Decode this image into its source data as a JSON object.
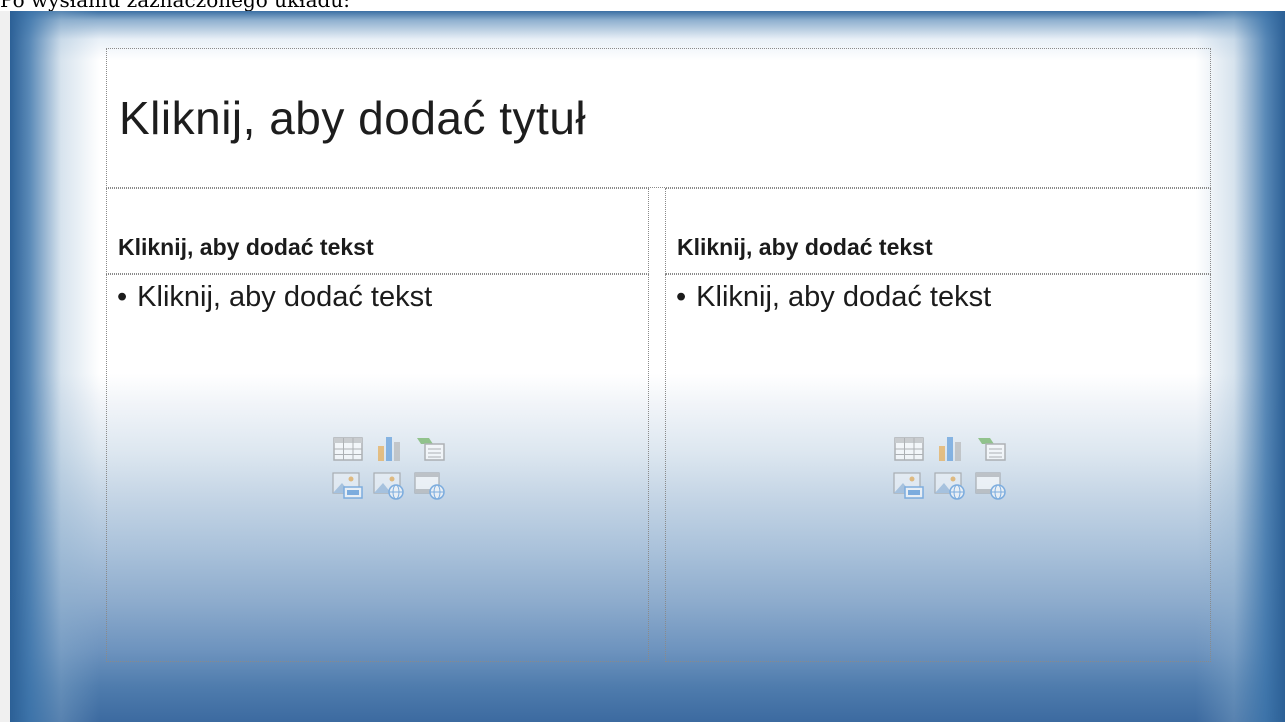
{
  "caption": {
    "text": "Po wysłaniu zaznaczonego układu:"
  },
  "slide": {
    "title_placeholder": "Kliknij, aby dodać tytuł",
    "columns": [
      {
        "heading_placeholder": "Kliknij, aby dodać tekst",
        "bullet": "•",
        "body_placeholder": "Kliknij, aby dodać tekst",
        "insert_icons": [
          "table-icon",
          "chart-icon",
          "smartart-icon",
          "picture-icon",
          "online-picture-icon",
          "video-icon"
        ]
      },
      {
        "heading_placeholder": "Kliknij, aby dodać tekst",
        "bullet": "•",
        "body_placeholder": "Kliknij, aby dodać tekst",
        "insert_icons": [
          "table-icon",
          "chart-icon",
          "smartart-icon",
          "picture-icon",
          "online-picture-icon",
          "video-icon"
        ]
      }
    ],
    "colors": {
      "edge_blue": "#2c6096",
      "bottom_blue": "#3c6aa0",
      "icon_gray": "#8d8d8d",
      "icon_orange": "#e8a33c",
      "icon_blue": "#4a90d9",
      "icon_green": "#5ca84a"
    }
  }
}
